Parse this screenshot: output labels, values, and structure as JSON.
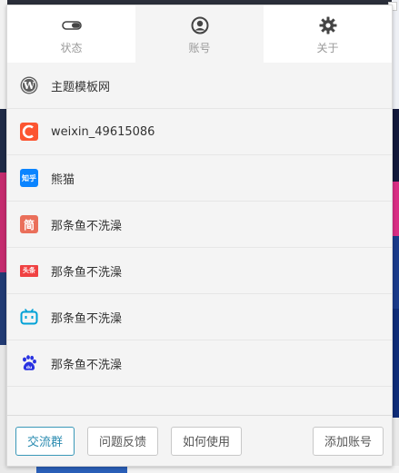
{
  "tabs": [
    {
      "label": "状态",
      "icon": "toggle-icon"
    },
    {
      "label": "账号",
      "icon": "user-circle-icon",
      "active": true
    },
    {
      "label": "关于",
      "icon": "gear-icon"
    }
  ],
  "accounts": [
    {
      "platform": "wordpress",
      "name": "主题模板网"
    },
    {
      "platform": "csdn",
      "name": "weixin_49615086"
    },
    {
      "platform": "zhihu",
      "name": "熊猫",
      "logo_text": "知乎"
    },
    {
      "platform": "jianshu",
      "name": "那条鱼不洗澡",
      "logo_text": "简"
    },
    {
      "platform": "toutiao",
      "name": "那条鱼不洗澡",
      "logo_text": "头条"
    },
    {
      "platform": "bilibili",
      "name": "那条鱼不洗澡"
    },
    {
      "platform": "baidu",
      "name": "那条鱼不洗澡"
    }
  ],
  "footer": {
    "group_label": "交流群",
    "feedback_label": "问题反馈",
    "howto_label": "如何使用",
    "add_account_label": "添加账号"
  },
  "colors": {
    "accent": "#2a8bb0",
    "csdn": "#fc5531",
    "zhihu": "#0a84ff",
    "jianshu": "#ea6f5a",
    "toutiao": "#f04142",
    "bilibili": "#00a1d6",
    "baidu": "#2932e1"
  }
}
